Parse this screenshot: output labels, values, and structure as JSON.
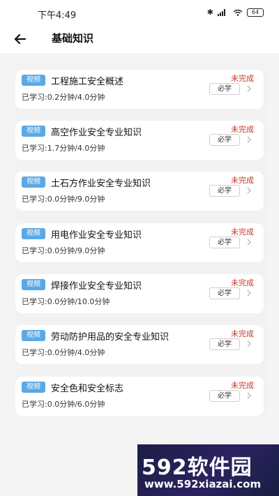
{
  "status_bar": {
    "time": "下午4:49",
    "battery": "64",
    "icons": [
      "bluetooth-icon",
      "signal-icon",
      "wifi-icon",
      "battery-icon"
    ]
  },
  "header": {
    "back_icon": "arrow-left-icon",
    "title": "基础知识"
  },
  "courses": [
    {
      "tag": "视频",
      "title": "工程施工安全概述",
      "progress": "已学习:0.2分钟/4.0分钟",
      "status": "未完成",
      "required": "必学"
    },
    {
      "tag": "视频",
      "title": "高空作业安全专业知识",
      "progress": "已学习:1.7分钟/4.0分钟",
      "status": "未完成",
      "required": "必学"
    },
    {
      "tag": "视频",
      "title": "土石方作业安全专业知识",
      "progress": "已学习:0.0分钟/9.0分钟",
      "status": "未完成",
      "required": "必学"
    },
    {
      "tag": "视频",
      "title": "用电作业安全专业知识",
      "progress": "已学习:0.0分钟/9.0分钟",
      "status": "未完成",
      "required": "必学"
    },
    {
      "tag": "视频",
      "title": "焊接作业安全专业知识",
      "progress": "已学习:0.0分钟/10.0分钟",
      "status": "未完成",
      "required": "必学"
    },
    {
      "tag": "视频",
      "title": "劳动防护用品的安全专业知识",
      "progress": "已学习:0.0分钟/4.0分钟",
      "status": "未完成",
      "required": "必学"
    },
    {
      "tag": "视频",
      "title": "安全色和安全标志",
      "progress": "已学习:0.0分钟/6.0分钟",
      "status": "未完成",
      "required": "必学"
    }
  ],
  "watermark": {
    "logo": "592软件园",
    "url": "www.592xiazai.com"
  },
  "colors": {
    "tag_bg": "#5aa9e6",
    "status_red": "#c23a2b",
    "page_bg": "#f4f4f4"
  }
}
